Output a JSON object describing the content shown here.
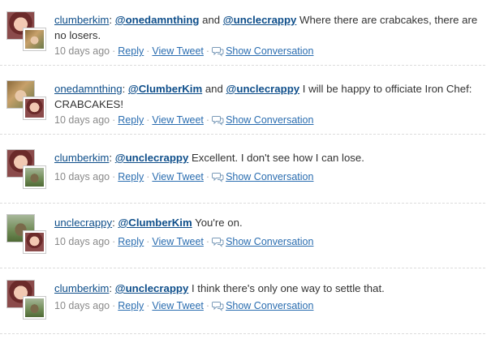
{
  "links": {
    "reply": "Reply",
    "view_tweet": "View Tweet",
    "show_conversation": "Show Conversation",
    "separator": "·"
  },
  "icons": {
    "conversation": "speech-bubble-icon"
  },
  "colors": {
    "link": "#0e4e8a",
    "meta_link": "#2a6db0",
    "meta_text": "#8a8a8a",
    "divider": "#dcdcdc"
  },
  "tweets": [
    {
      "author": "clumberkim",
      "text_parts": [
        ": ",
        "@onedamnthing",
        " and ",
        "@unclecrappy",
        " Where there are crabcakes, there are no losers."
      ],
      "time": "10 days ago"
    },
    {
      "author": "onedamnthing",
      "text_parts": [
        ": ",
        "@ClumberKim",
        " and ",
        "@unclecrappy",
        " I will be happy to officiate Iron Chef: CRABCAKES!"
      ],
      "time": "10 days ago"
    },
    {
      "author": "clumberkim",
      "text_parts": [
        ": ",
        "@unclecrappy",
        " Excellent. I don't see how I can lose."
      ],
      "time": "10 days ago"
    },
    {
      "author": "unclecrappy",
      "text_parts": [
        ": ",
        "@ClumberKim",
        " You're on."
      ],
      "time": "10 days ago"
    },
    {
      "author": "clumberkim",
      "text_parts": [
        ": ",
        "@unclecrappy",
        " I think there's only one way to settle that."
      ],
      "time": "10 days ago"
    }
  ]
}
